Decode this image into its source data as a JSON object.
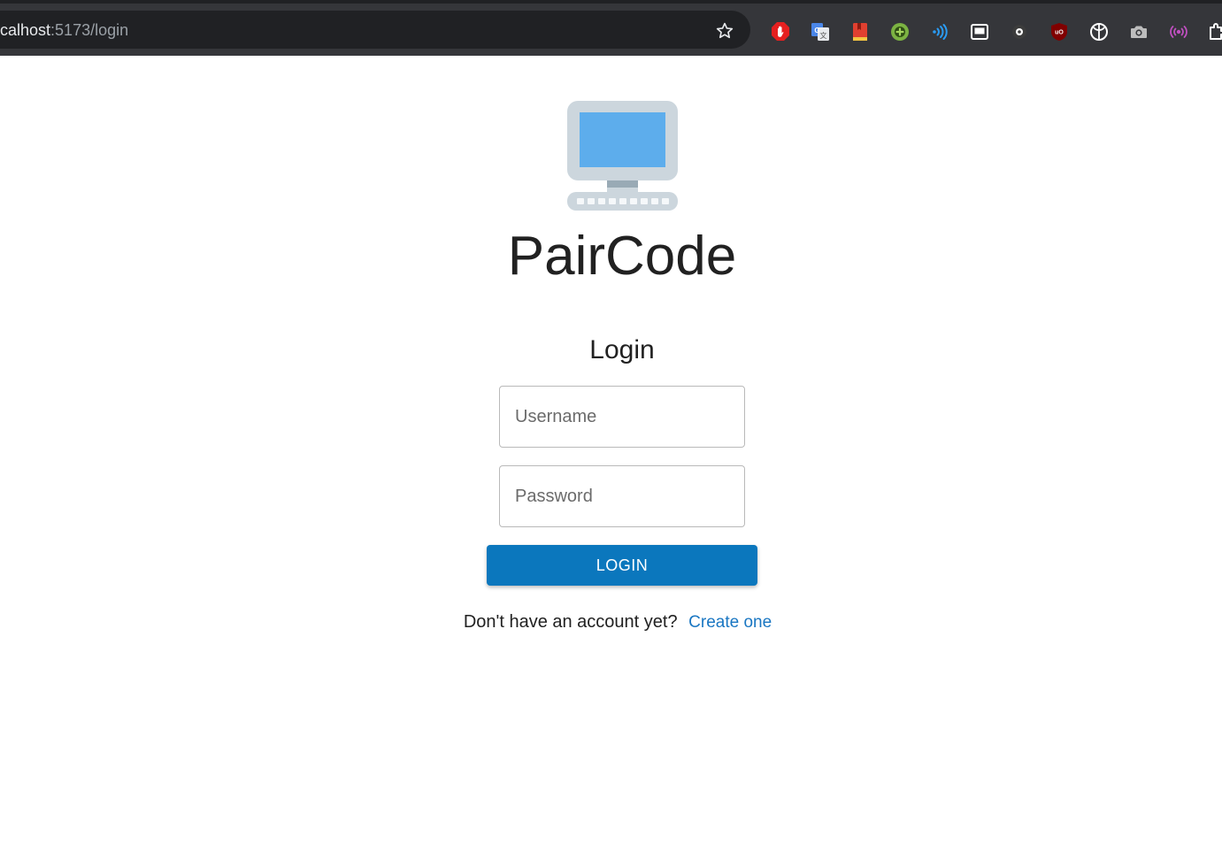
{
  "browser": {
    "url_host": "calhost",
    "url_path": ":5173/login",
    "extensions": [
      {
        "name": "adblock-icon",
        "color": "#e62020"
      },
      {
        "name": "google-translate-icon",
        "color": "#4a86e8"
      },
      {
        "name": "bookmark-book-icon",
        "color": "#e04030"
      },
      {
        "name": "add-circle-icon",
        "color": "#7cb342"
      },
      {
        "name": "wireless-icon",
        "color": "#2a9cf4"
      },
      {
        "name": "picture-in-picture-icon",
        "color": "#ffffff"
      },
      {
        "name": "record-icon",
        "color": "#ffffff"
      },
      {
        "name": "ublock-origin-icon",
        "color": "#800000"
      },
      {
        "name": "brain-icon",
        "color": "#ffffff"
      },
      {
        "name": "camera-icon",
        "color": "#bdbdbd"
      },
      {
        "name": "broadcast-icon",
        "color": "#c050c0"
      },
      {
        "name": "extensions-puzzle-icon",
        "color": "#ffffff"
      }
    ]
  },
  "app": {
    "title": "PairCode",
    "logo": "computer-icon"
  },
  "form": {
    "heading": "Login",
    "username_placeholder": "Username",
    "password_placeholder": "Password",
    "submit_label": "LOGIN",
    "prompt_text": "Don't have an account yet?",
    "signup_link": "Create one"
  },
  "colors": {
    "primary": "#0b77bd",
    "link": "#1976c2",
    "chrome_dark": "#35363a",
    "omnibox": "#202124"
  }
}
